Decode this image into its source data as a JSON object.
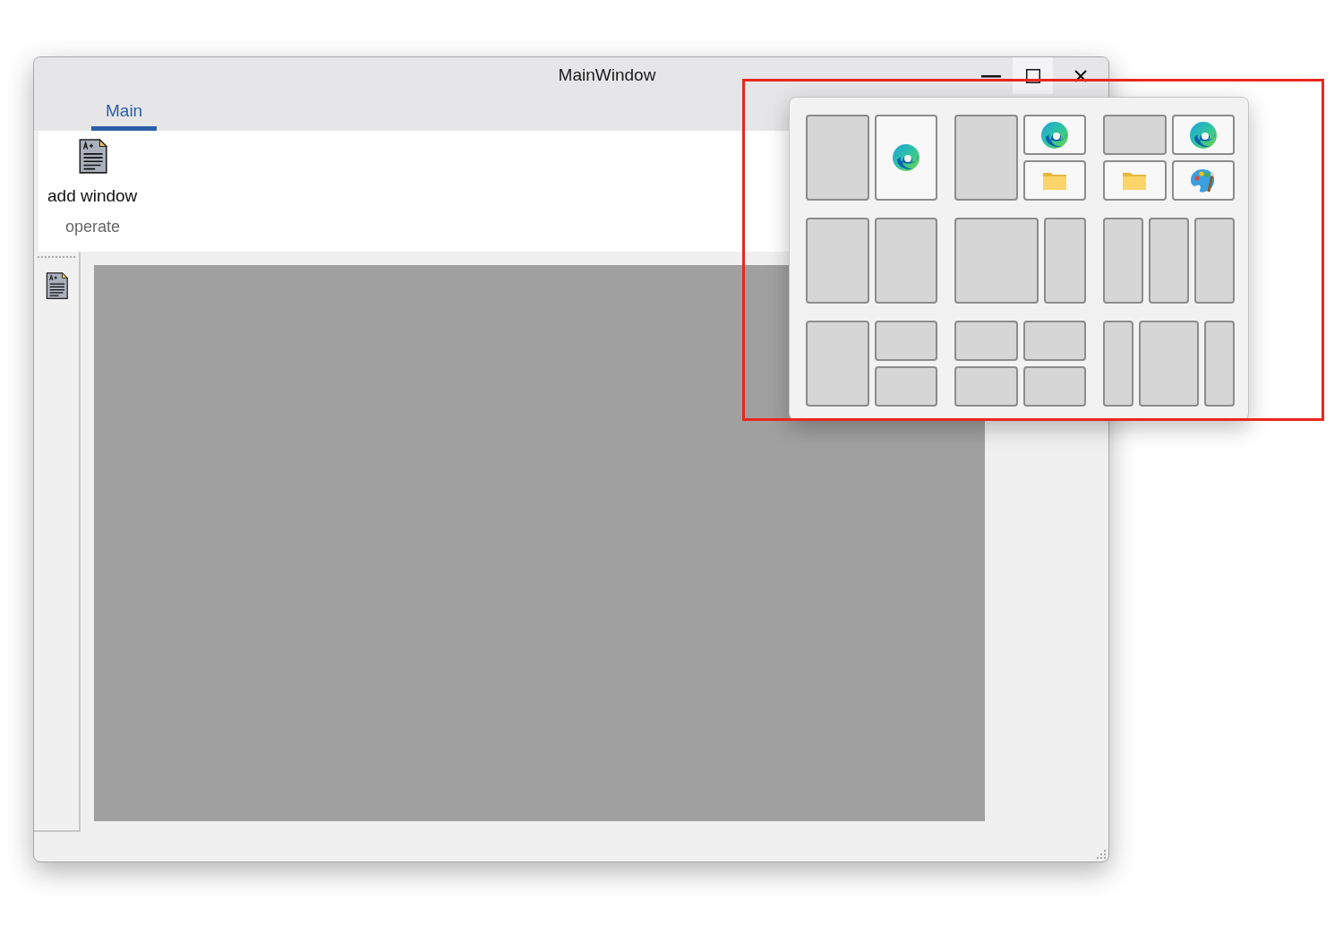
{
  "window": {
    "title": "MainWindow",
    "maximize_hovered": true
  },
  "tabs": [
    {
      "label": "Main",
      "selected": true
    }
  ],
  "ribbon": {
    "buttons": [
      {
        "label": "add window"
      }
    ],
    "group_label": "operate"
  },
  "snap_layouts": [
    {
      "kind": "halves",
      "zones": [
        {
          "kind": "empty"
        },
        {
          "kind": "browser"
        }
      ]
    },
    {
      "kind": "stack",
      "zones": [
        {
          "kind": "empty"
        },
        {
          "kind": "browser"
        },
        {
          "kind": "folder"
        }
      ]
    },
    {
      "kind": "quad",
      "zones": [
        {
          "kind": "empty"
        },
        {
          "kind": "browser"
        },
        {
          "kind": "folder"
        },
        {
          "kind": "palette"
        }
      ]
    },
    {
      "kind": "halves",
      "zones": [
        {
          "kind": "empty"
        },
        {
          "kind": "empty"
        }
      ]
    },
    {
      "kind": "wide",
      "zones": [
        {
          "kind": "empty"
        },
        {
          "kind": "empty"
        }
      ]
    },
    {
      "kind": "thirds",
      "zones": [
        {
          "kind": "empty"
        },
        {
          "kind": "empty"
        },
        {
          "kind": "empty"
        }
      ]
    },
    {
      "kind": "stack",
      "zones": [
        {
          "kind": "empty"
        },
        {
          "kind": "empty"
        },
        {
          "kind": "empty"
        }
      ]
    },
    {
      "kind": "quad",
      "zones": [
        {
          "kind": "empty"
        },
        {
          "kind": "empty"
        },
        {
          "kind": "empty"
        },
        {
          "kind": "empty"
        }
      ]
    },
    {
      "kind": "center",
      "zones": [
        {
          "kind": "empty"
        },
        {
          "kind": "empty"
        },
        {
          "kind": "empty"
        }
      ]
    }
  ]
}
